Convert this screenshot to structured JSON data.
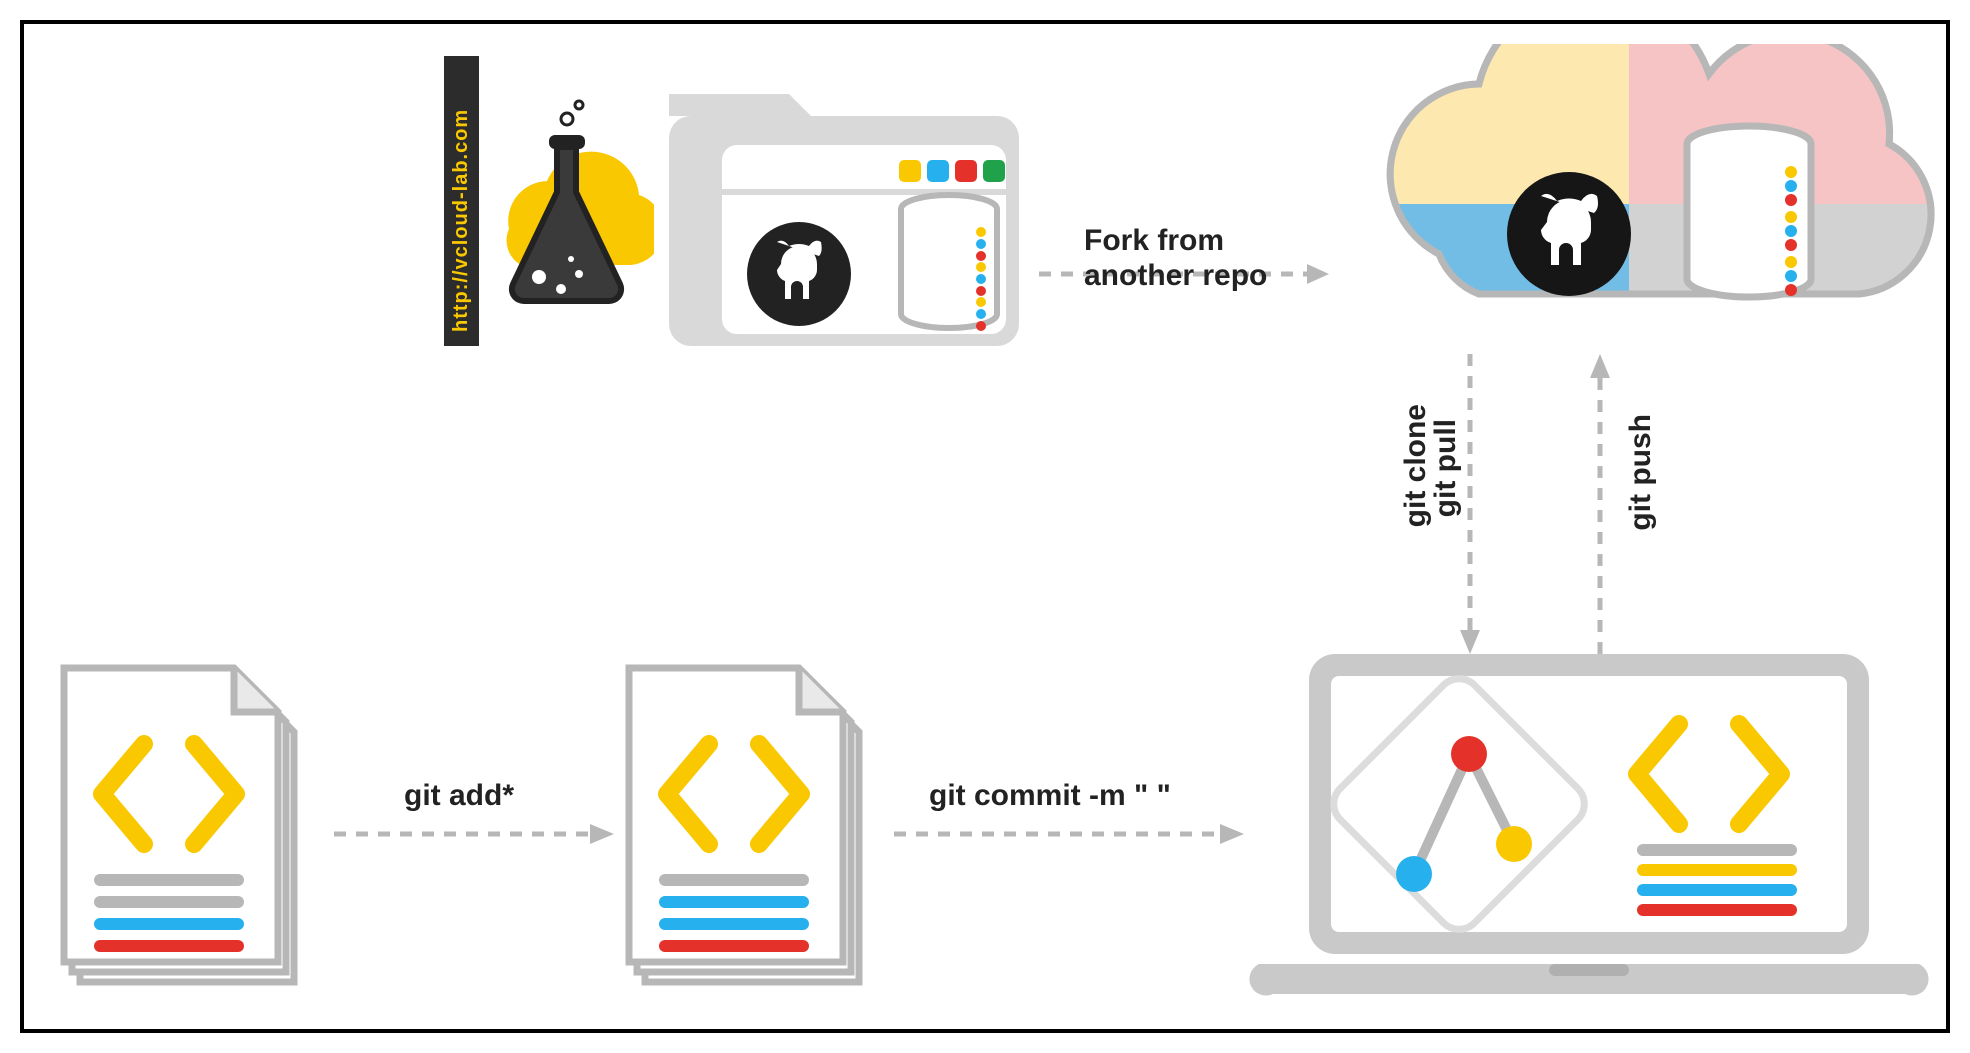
{
  "brand": {
    "url_text": "http://vcloud-lab.com"
  },
  "labels": {
    "fork": "Fork from\nanother repo",
    "git_add": "git add*",
    "git_commit": "git commit -m \" \"",
    "git_clone": "git clone",
    "git_pull": "git pull",
    "git_push": "git push"
  },
  "colors": {
    "gray": "#b7b7b7",
    "lightgray": "#d9d9d9",
    "yellow": "#fac800",
    "orange_soft": "#fde8b0",
    "pink_soft": "#f6c4c4",
    "blue_soft": "#72bde6",
    "gray_soft": "#d2d2d2",
    "blue": "#26b1ee",
    "red": "#e4322b",
    "green": "#1fa24a",
    "dark": "#222222"
  }
}
